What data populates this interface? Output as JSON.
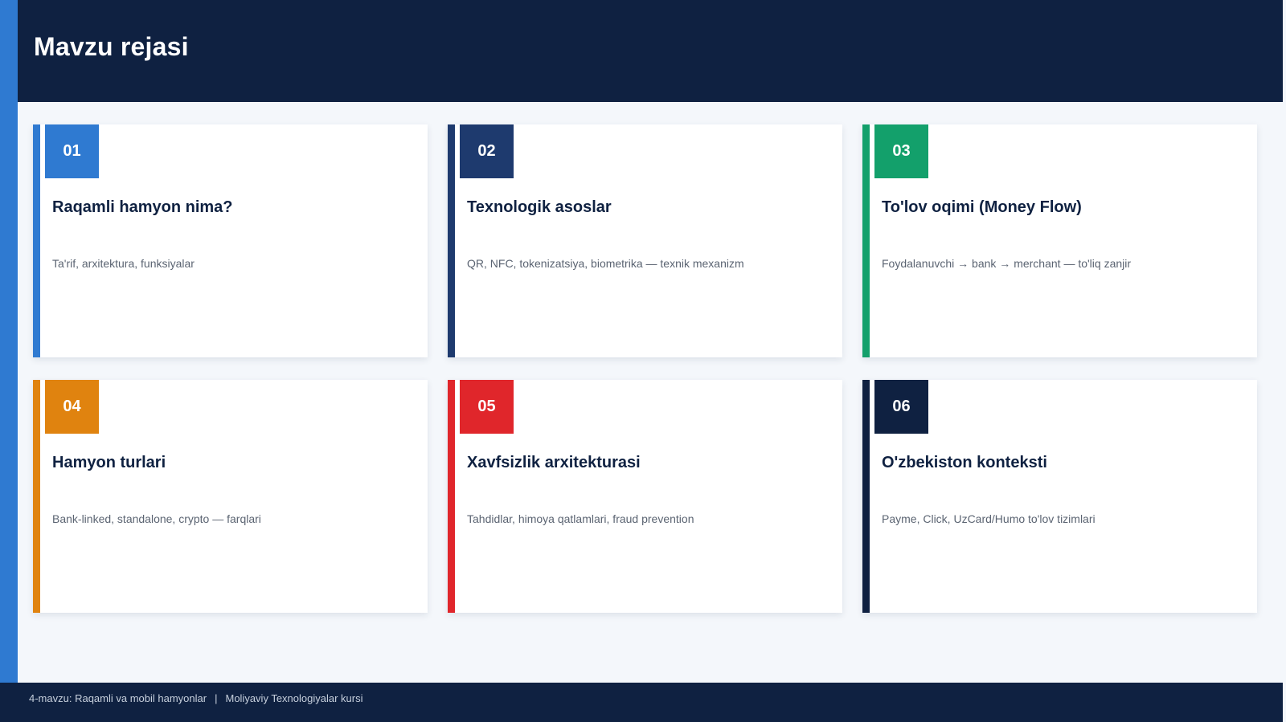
{
  "slide": {
    "title": "Mavzu rejasi"
  },
  "cards": [
    {
      "number": "01",
      "title": "Raqamli hamyon nima?",
      "description": "Ta'rif, arxitektura, funksiyalar",
      "color": "#2f7ad1"
    },
    {
      "number": "02",
      "title": "Texnologik asoslar",
      "description": "QR, NFC, tokenizatsiya, biometrika — texnik mexanizm",
      "color": "#1e3a6e"
    },
    {
      "number": "03",
      "title": "To'lov oqimi (Money Flow)",
      "description": "Foydalanuvchi → bank → merchant — to'liq zanjir",
      "color": "#13a06b"
    },
    {
      "number": "04",
      "title": "Hamyon turlari",
      "description": "Bank-linked, standalone, crypto — farqlari",
      "color": "#e0830f"
    },
    {
      "number": "05",
      "title": "Xavfsizlik arxitekturasi",
      "description": "Tahdidlar, himoya qatlamlari, fraud prevention",
      "color": "#e0262b"
    },
    {
      "number": "06",
      "title": "O'zbekiston konteksti",
      "description": "Payme, Click, UzCard/Humo to'lov tizimlari",
      "color": "#0f2141"
    }
  ],
  "footer": {
    "topic": "4-mavzu: Raqamli va mobil hamyonlar",
    "separator": "|",
    "course": "Moliyaviy Texnologiyalar kursi"
  }
}
